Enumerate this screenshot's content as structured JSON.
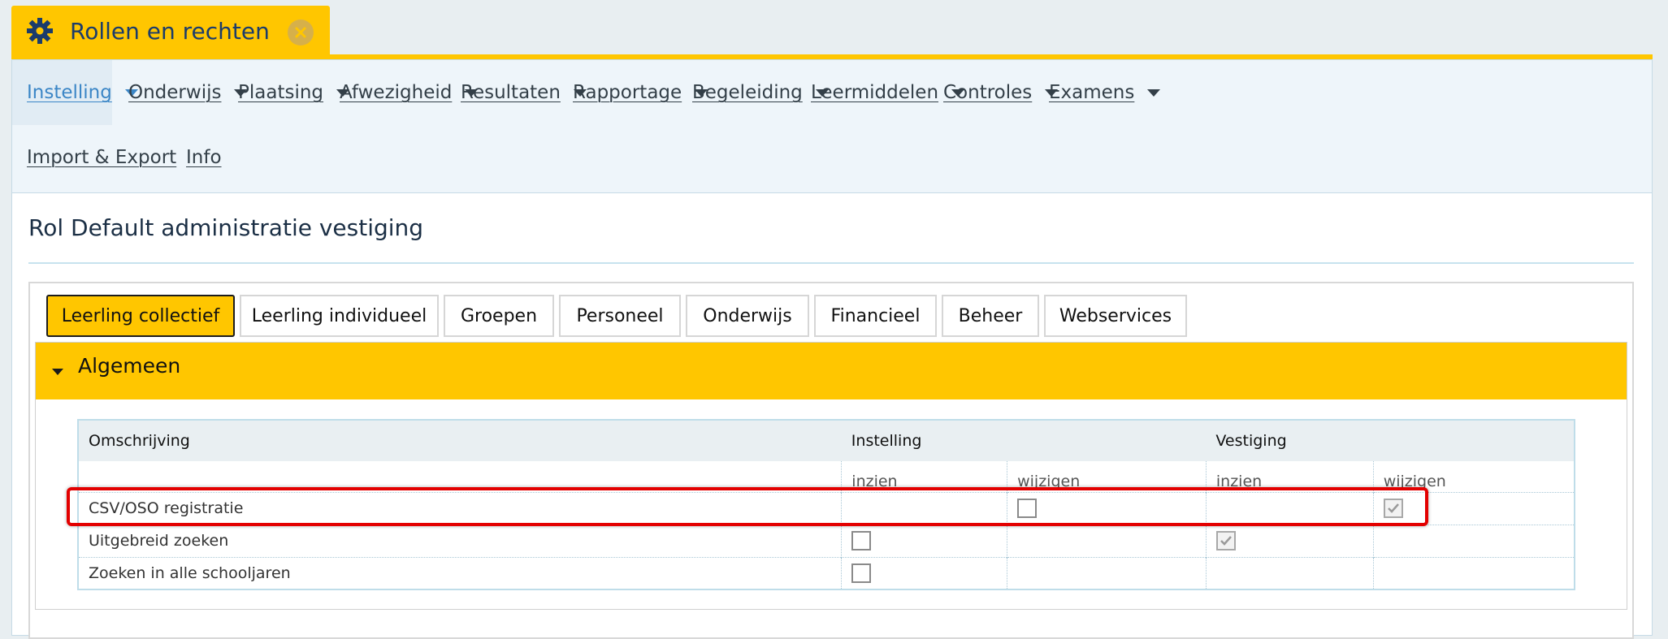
{
  "app_tab": {
    "title": "Rollen en rechten",
    "icon": "gear-icon",
    "close_icon": "close-icon"
  },
  "colors": {
    "accent": "#ffc600",
    "nav_text": "#333f48",
    "active_nav": "#3b86c6",
    "title": "#1b3c6b",
    "highlight": "#e30000"
  },
  "menu": {
    "items": [
      {
        "label": "Instelling",
        "has_dropdown": true,
        "active": true
      },
      {
        "label": "Onderwijs",
        "has_dropdown": true
      },
      {
        "label": "Plaatsing",
        "has_dropdown": true
      },
      {
        "label": "Afwezigheid",
        "has_dropdown": true
      },
      {
        "label": "Resultaten",
        "has_dropdown": true
      },
      {
        "label": "Rapportage",
        "has_dropdown": true
      },
      {
        "label": "Begeleiding",
        "has_dropdown": true
      },
      {
        "label": "Leermiddelen",
        "has_dropdown": true
      },
      {
        "label": "Controles",
        "has_dropdown": true
      },
      {
        "label": "Examens",
        "has_dropdown": true
      },
      {
        "label": "Import & Export",
        "has_dropdown": false
      },
      {
        "label": "Info",
        "has_dropdown": false
      }
    ]
  },
  "page": {
    "title": "Rol Default administratie vestiging"
  },
  "tabs": [
    {
      "label": "Leerling collectief",
      "active": true
    },
    {
      "label": "Leerling individueel"
    },
    {
      "label": "Groepen"
    },
    {
      "label": "Personeel"
    },
    {
      "label": "Onderwijs"
    },
    {
      "label": "Financieel"
    },
    {
      "label": "Beheer"
    },
    {
      "label": "Webservices"
    }
  ],
  "section": {
    "title": "Algemeen",
    "expanded": true
  },
  "table": {
    "headers": {
      "description": "Omschrijving",
      "instelling": "Instelling",
      "vestiging": "Vestiging"
    },
    "subheaders": {
      "inzien_1": "inzien",
      "wijzigen_1": "wijzigen",
      "inzien_2": "inzien",
      "wijzigen_2": "wijzigen"
    },
    "rows": [
      {
        "label": "CSV/OSO registratie",
        "instelling_inzien": null,
        "instelling_wijzigen": false,
        "vestiging_inzien": null,
        "vestiging_wijzigen": true,
        "highlighted": true
      },
      {
        "label": "Uitgebreid zoeken",
        "instelling_inzien": false,
        "instelling_wijzigen": null,
        "vestiging_inzien": true,
        "vestiging_wijzigen": null
      },
      {
        "label": "Zoeken in alle schooljaren",
        "instelling_inzien": false,
        "instelling_wijzigen": null,
        "vestiging_inzien": null,
        "vestiging_wijzigen": null
      }
    ]
  }
}
